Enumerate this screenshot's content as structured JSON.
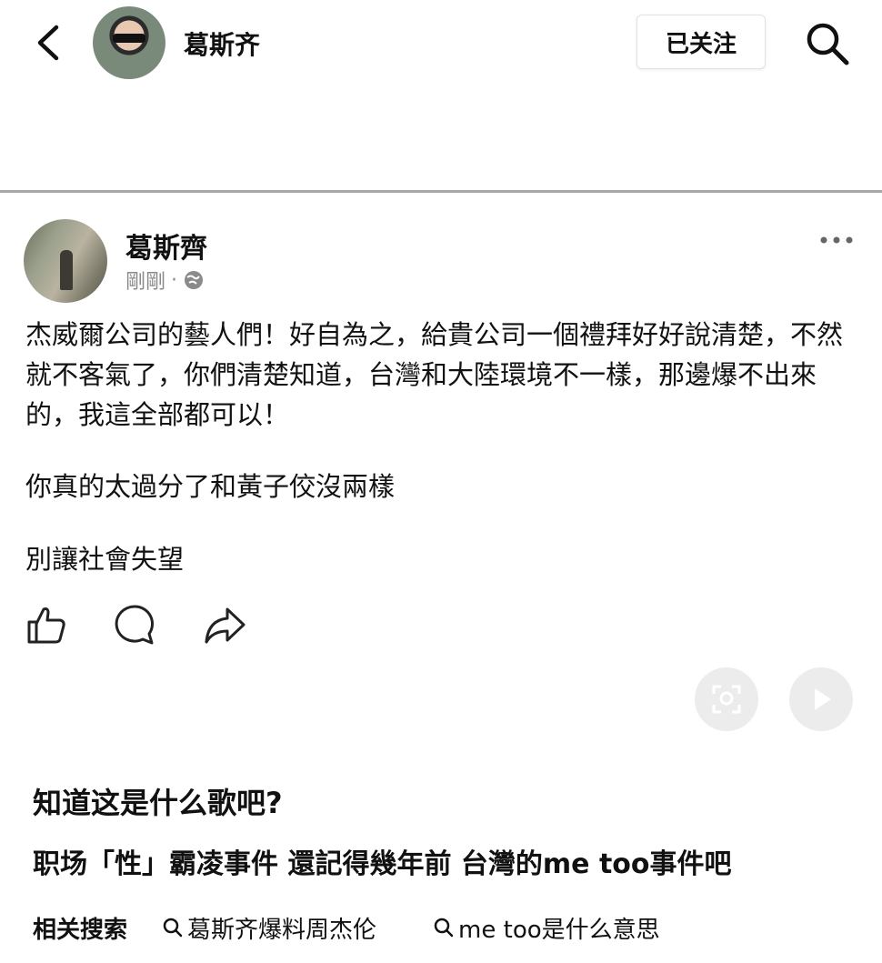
{
  "header": {
    "account_name": "葛斯齐",
    "follow_label": "已关注"
  },
  "post": {
    "author": "葛斯齊",
    "time": "剛剛",
    "dot": "·",
    "body": "杰威爾公司的藝人們！好自為之，給貴公司一個禮拜好好說清楚，不然就不客氣了，你們清楚知道，台灣和大陸環境不一樣，那邊爆不出來的，我這全部都可以！",
    "line2": "你真的太過分了和黃子佼沒兩樣",
    "line3": "別讓社會失望"
  },
  "actions": [
    "like-icon",
    "comment-icon",
    "share-icon"
  ],
  "caption": {
    "question": "知道这是什么歌吧?",
    "subtitle": "职场「性」霸凌事件 還記得幾年前 台灣的me too事件吧"
  },
  "related": {
    "label": "相关搜索",
    "items": [
      "葛斯齐爆料周杰伦",
      "me too是什么意思"
    ]
  },
  "colors": {
    "divider": "#a8a8a8",
    "meta_text": "#8a8a8a",
    "float_button": "#ececec"
  }
}
